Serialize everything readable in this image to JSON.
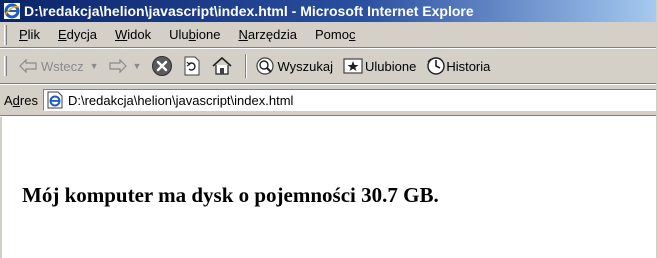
{
  "window": {
    "title": "D:\\redakcja\\helion\\javascript\\index.html - Microsoft Internet Explore"
  },
  "menu": [
    {
      "label": "Plik",
      "accel": "P",
      "rest": "lik"
    },
    {
      "label": "Edycja",
      "accel": "E",
      "rest": "dycja"
    },
    {
      "label": "Widok",
      "accel": "W",
      "rest": "idok"
    },
    {
      "label": "Ulubione",
      "pre": "Ulu",
      "accel": "b",
      "rest": "ione"
    },
    {
      "label": "Narzędzia",
      "accel": "N",
      "rest": "arzędzia"
    },
    {
      "label": "Pomoc",
      "pre": "Pomo",
      "accel": "c",
      "rest": ""
    }
  ],
  "toolbar": {
    "back_label": "Wstecz",
    "search_label": "Wyszukaj",
    "favorites_label": "Ulubione",
    "history_label": "Historia",
    "back_icon": "back-arrow-icon",
    "forward_icon": "forward-arrow-icon",
    "stop_icon": "stop-icon",
    "refresh_icon": "refresh-icon",
    "home_icon": "home-icon"
  },
  "address": {
    "label": "Adres",
    "label_pre": "A",
    "label_accel": "d",
    "label_rest": "res",
    "url": "D:\\redakcja\\helion\\javascript\\index.html"
  },
  "page": {
    "text": "Mój komputer ma dysk o pojemności 30.7 GB."
  },
  "colors": {
    "titlebar_start": "#0a246a",
    "titlebar_end": "#a6caf0",
    "chrome": "#d4d0c8"
  }
}
